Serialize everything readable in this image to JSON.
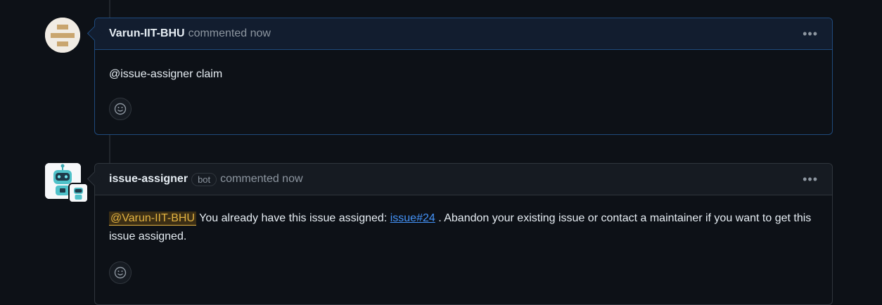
{
  "comments": [
    {
      "author": "Varun-IIT-BHU",
      "meta": "commented now",
      "body": "@issue-assigner claim",
      "menu_icon": "kebab-horizontal-icon",
      "reaction_icon": "smiley-icon"
    },
    {
      "author": "issue-assigner",
      "badge": "bot",
      "meta": "commented now",
      "mention": "@Varun-IIT-BHU",
      "text_before_link": " You already have this issue assigned: ",
      "link": "issue#24",
      "text_after_link": " . Abandon your existing issue or contact a maintainer if you want to get this issue assigned.",
      "menu_icon": "kebab-horizontal-icon",
      "reaction_icon": "smiley-icon"
    }
  ],
  "colors": {
    "background": "#0d1117",
    "border": "#30363d",
    "highlight_border": "#1f4a7c",
    "link": "#4493f8",
    "mention": "#e3b341"
  }
}
